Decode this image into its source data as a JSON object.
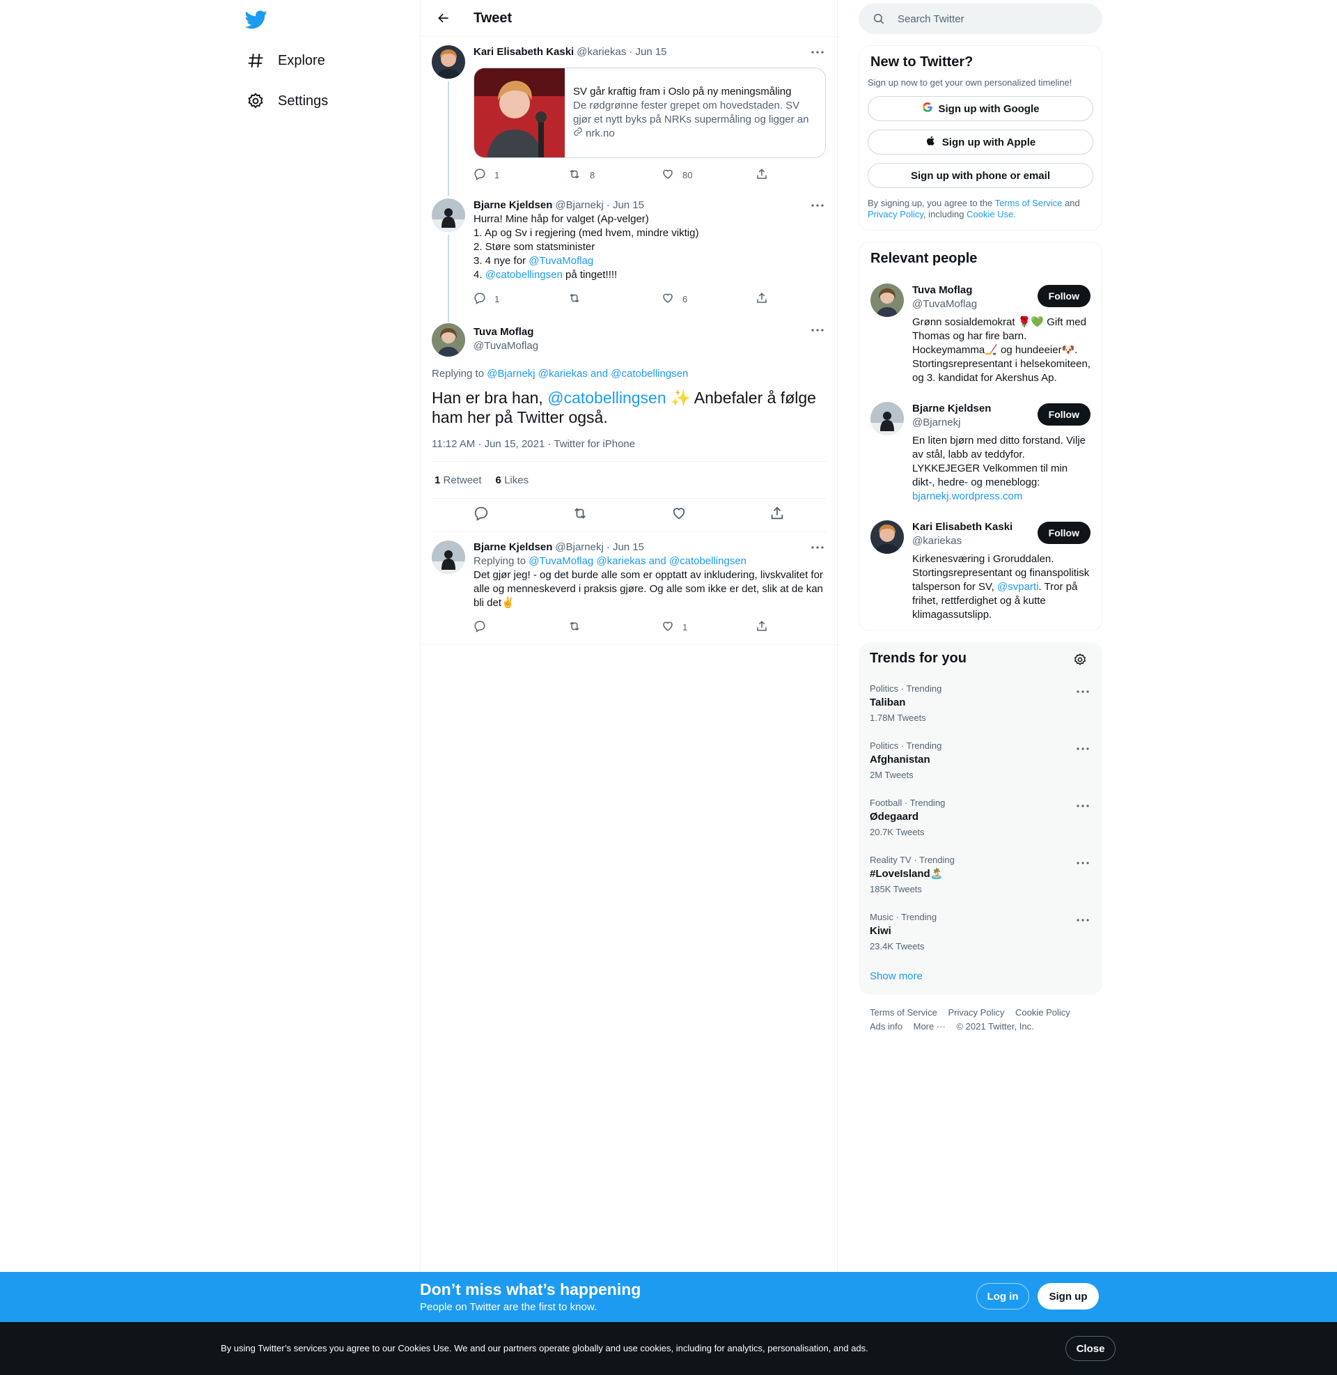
{
  "nav": {
    "explore": "Explore",
    "settings": "Settings"
  },
  "header": {
    "title": "Tweet"
  },
  "thread": [
    {
      "name": "Kari Elisabeth Kaski",
      "handle": "@kariekas",
      "date": "· Jun 15",
      "card": {
        "title": "SV går kraftig fram i Oslo på ny meningsmåling",
        "desc": "De rødgrønne fester grepet om hovedstaden. SV gjør et nytt byks på NRKs supermåling og ligger an til tr...",
        "domain": "nrk.no"
      },
      "replies": "1",
      "retweets": "8",
      "likes": "80"
    },
    {
      "name": "Bjarne Kjeldsen",
      "handle": "@Bjarnekj",
      "date": "· Jun 15",
      "lines": [
        "Hurra! Mine håp for valget (Ap-velger)",
        "1. Ap og Sv i regjering (med hvem, mindre viktig)",
        "2. Støre som statsminister"
      ],
      "line3_prefix": "3. 4 nye for ",
      "line3_mention": "@TuvaMoflag",
      "line4_prefix": "4. ",
      "line4_mention": "@catobellingsen",
      "line4_suffix": " på tinget!!!!",
      "replies": "1",
      "retweets": "",
      "likes": "6"
    }
  ],
  "focus": {
    "name": "Tuva Moflag",
    "handle": "@TuvaMoflag",
    "replying_label": "Replying to ",
    "replying_to": "@Bjarnekj @kariekas and @catobellingsen",
    "text_prefix": "Han er bra han, ",
    "text_mention": "@catobellingsen",
    "text_suffix": " ✨ Anbefaler å følge ham her på Twitter også.",
    "meta": "11:12 AM · Jun 15, 2021 · Twitter for iPhone",
    "retweets_count": "1",
    "retweets_label": "Retweet",
    "likes_count": "6",
    "likes_label": "Likes"
  },
  "reply": {
    "name": "Bjarne Kjeldsen",
    "handle": "@Bjarnekj",
    "date": "· Jun 15",
    "replying_label": "Replying to ",
    "replying_to": "@TuvaMoflag @kariekas and @catobellingsen",
    "text": "Det gjør jeg! - og det burde alle som er opptatt av inkludering, livskvalitet for alle og menneskeverd i praksis gjøre. Og alle som ikke er det, slik at de kan bli det✌️",
    "replies": "",
    "retweets": "",
    "likes": "1"
  },
  "search": {
    "placeholder": "Search Twitter"
  },
  "signup": {
    "title": "New to Twitter?",
    "subtitle": "Sign up now to get your own personalized timeline!",
    "google": "Sign up with Google",
    "apple": "Sign up with Apple",
    "phone": "Sign up with phone or email",
    "legal_1": "By signing up, you agree to the ",
    "terms": "Terms of Service",
    "legal_2": " and ",
    "privacy": "Privacy Policy",
    "legal_3": ", including ",
    "cookie": "Cookie Use."
  },
  "relevant": {
    "title": "Relevant people",
    "follow": "Follow",
    "people": [
      {
        "name": "Tuva Moflag",
        "handle": "@TuvaMoflag",
        "bio": "Grønn sosialdemokrat 🌹💚 Gift med Thomas og har fire barn. Hockeymamma🏒 og hundeeier🐶. Stortingsrepresentant i helsekomiteen, og 3. kandidat for Akershus Ap."
      },
      {
        "name": "Bjarne Kjeldsen",
        "handle": "@Bjarnekj",
        "bio": "En liten bjørn med ditto forstand. Vilje av stål, labb av teddyfor. LYKKEJEGER Velkommen til min dikt-, hedre- og meneblogg: ",
        "link": "bjarnekj.wordpress.com"
      },
      {
        "name": "Kari Elisabeth Kaski",
        "handle": "@kariekas",
        "bio": "Kirkenesværing i Groruddalen. Stortingsrepresentant og finanspolitisk talsperson for SV, ",
        "mention": "@svparti",
        "bio2": ". Tror på frihet, rettferdighet og å kutte klimagassutslipp."
      }
    ]
  },
  "trends": {
    "title": "Trends for you",
    "items": [
      {
        "meta": "Politics · Trending",
        "name": "Taliban",
        "count": "1.78M Tweets"
      },
      {
        "meta": "Politics · Trending",
        "name": "Afghanistan",
        "count": "2M Tweets"
      },
      {
        "meta": "Football · Trending",
        "name": "Ødegaard",
        "count": "20.7K Tweets"
      },
      {
        "meta": "Reality TV · Trending",
        "name": "#LoveIsland🏝️",
        "count": "185K Tweets"
      },
      {
        "meta": "Music · Trending",
        "name": "Kiwi",
        "count": "23.4K Tweets"
      }
    ],
    "show_more": "Show more"
  },
  "footer": {
    "terms": "Terms of Service",
    "privacy": "Privacy Policy",
    "cookie": "Cookie Policy",
    "ads": "Ads info",
    "more": "More ···",
    "copyright": "© 2021 Twitter, Inc."
  },
  "bottom": {
    "headline": "Don’t miss what’s happening",
    "sub": "People on Twitter are the first to know.",
    "login": "Log in",
    "signup": "Sign up"
  },
  "cookies": {
    "text": "By using Twitter’s services you agree to our Cookies Use. We and our partners operate globally and use cookies, including for analytics, personalisation, and ads.",
    "close": "Close"
  },
  "colors": {
    "accent": "#1d9bf0",
    "text": "#0f1419",
    "muted": "#536471",
    "border": "#eff3f4"
  }
}
